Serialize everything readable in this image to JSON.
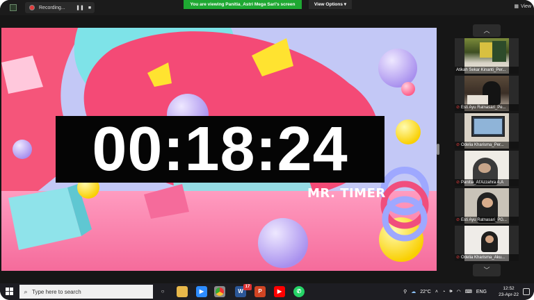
{
  "top_bar": {
    "recording_label": "Recording...",
    "pause_icon": "pause-icon",
    "stop_icon": "stop-icon",
    "share_banner": "You are viewing Panitia_Astri Mega Sari's screen",
    "view_options": "View Options",
    "view_label": "View"
  },
  "shared_screen": {
    "timer": "00:18:24",
    "brand": "MR. TIMER"
  },
  "gallery": {
    "participants": [
      {
        "name": "Atikah Sekar Kinanti_Per...",
        "muted": false
      },
      {
        "name": "Esti Ayu Ratnasari_Pe...",
        "muted": true
      },
      {
        "name": "Odelia Kharisma_Per...",
        "muted": true
      },
      {
        "name": "Panitia_Al'Azzahra A.A",
        "muted": true
      },
      {
        "name": "Esti Ayu Ratnasari_PG...",
        "muted": true
      },
      {
        "name": "Odelia Kharisma_Aku...",
        "muted": true
      }
    ]
  },
  "taskbar": {
    "search_placeholder": "Type here to search",
    "chrome_badge": "17",
    "weather": "22°C",
    "language": "ENG",
    "time": "12:52",
    "date": "23-Apr-22"
  },
  "colors": {
    "share_green": "#1ea832",
    "timer_bg": "#050505",
    "pink": "#f5557a",
    "cyan": "#7ee3e8",
    "lavender": "#b8a6f0",
    "yellow": "#ffe330"
  }
}
